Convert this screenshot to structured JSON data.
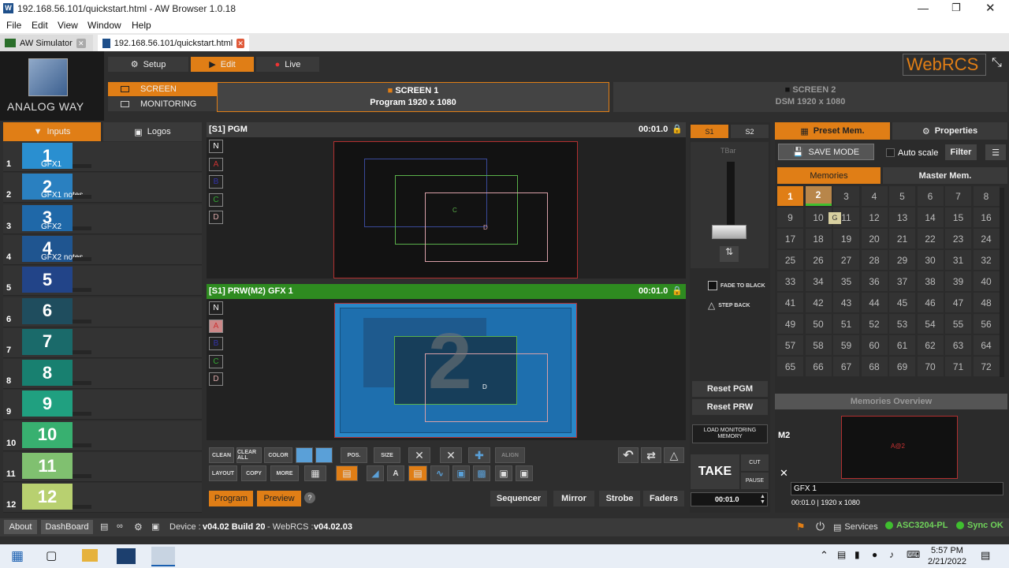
{
  "window": {
    "title": "192.168.56.101/quickstart.html - AW Browser 1.0.18"
  },
  "menu": [
    "File",
    "Edit",
    "View",
    "Window",
    "Help"
  ],
  "tabs": [
    {
      "label": "AW Simulator"
    },
    {
      "label": "192.168.56.101/quickstart.html"
    }
  ],
  "logo": {
    "brand": "ANALOG WAY",
    "webrcs": "WebRCS"
  },
  "modes": {
    "setup": "Setup",
    "edit": "Edit",
    "live": "Live"
  },
  "screens": {
    "screen_label": "SCREEN",
    "monitoring_label": "MONITORING",
    "s1_title": "SCREEN 1",
    "s1_sub": "Program 1920 x 1080",
    "s2_title": "SCREEN 2",
    "s2_sub": "DSM 1920 x 1080"
  },
  "left_tabs": {
    "inputs": "Inputs",
    "logos": "Logos"
  },
  "inputs": [
    {
      "n": "1",
      "big": "1",
      "label": "GFX1",
      "color": "#2a8fd0"
    },
    {
      "n": "2",
      "big": "2",
      "label": "GFX1 notes",
      "color": "#2a80c0"
    },
    {
      "n": "3",
      "big": "3",
      "label": "GFX2",
      "color": "#1f68a8"
    },
    {
      "n": "4",
      "big": "4",
      "label": "GFX2 notes",
      "color": "#1f5590"
    },
    {
      "n": "5",
      "big": "5",
      "label": "",
      "color": "#224488"
    },
    {
      "n": "6",
      "big": "6",
      "label": "",
      "color": "#1f4d5e"
    },
    {
      "n": "7",
      "big": "7",
      "label": "",
      "color": "#1a6a6a"
    },
    {
      "n": "8",
      "big": "8",
      "label": "",
      "color": "#188070"
    },
    {
      "n": "9",
      "big": "9",
      "label": "",
      "color": "#20a080"
    },
    {
      "n": "10",
      "big": "10",
      "label": "",
      "color": "#38b070"
    },
    {
      "n": "11",
      "big": "11",
      "label": "",
      "color": "#80c070"
    },
    {
      "n": "12",
      "big": "12",
      "label": "",
      "color": "#b8d070"
    }
  ],
  "pgm": {
    "title": "[S1] PGM",
    "time": "00:01.0"
  },
  "prw": {
    "title": "[S1] PRW(M2) GFX 1",
    "time": "00:01.0"
  },
  "layers": [
    "N",
    "A",
    "B",
    "C",
    "D"
  ],
  "canvas": {
    "c": "C",
    "d": "D",
    "big": "2"
  },
  "tools": {
    "clean": "CLEAN",
    "clear_all": "CLEAR ALL",
    "color": "COLOR",
    "pos": "POS.",
    "size": "SIZE",
    "align": "ALIGN",
    "layout": "LAYOUT",
    "copy": "COPY",
    "more": "MORE"
  },
  "bottom": {
    "program": "Program",
    "preview": "Preview",
    "help": "?",
    "sequencer": "Sequencer",
    "mirror": "Mirror",
    "strobe": "Strobe",
    "faders": "Faders"
  },
  "tbar": {
    "s1": "S1",
    "s2": "S2",
    "label": "TBar",
    "fade": "FADE TO BLACK",
    "step": "STEP BACK",
    "reset_pgm": "Reset PGM",
    "reset_prw": "Reset PRW",
    "load_mon": "LOAD MONITORING MEMORY",
    "take": "TAKE",
    "cut": "CUT",
    "pause": "PAUSE",
    "time": "00:01.0"
  },
  "right": {
    "preset_tab": "Preset Mem.",
    "props_tab": "Properties",
    "save_mode": "SAVE MODE",
    "autoscale": "Auto scale",
    "filter": "Filter",
    "memories": "Memories",
    "master": "Master Mem.",
    "overview": "Memories Overview",
    "m2": "M2",
    "g_badge": "G",
    "mini_label": "A@2",
    "name_value": "GFX 1",
    "info": "00:01.0 | 1920 x 1080"
  },
  "memories": [
    "1",
    "2",
    "3",
    "4",
    "5",
    "6",
    "7",
    "8",
    "9",
    "10",
    "11",
    "12",
    "13",
    "14",
    "15",
    "16",
    "17",
    "18",
    "19",
    "20",
    "21",
    "22",
    "23",
    "24",
    "25",
    "26",
    "27",
    "28",
    "29",
    "30",
    "31",
    "32",
    "33",
    "34",
    "35",
    "36",
    "37",
    "38",
    "39",
    "40",
    "41",
    "42",
    "43",
    "44",
    "45",
    "46",
    "47",
    "48",
    "49",
    "50",
    "51",
    "52",
    "53",
    "54",
    "55",
    "56",
    "57",
    "58",
    "59",
    "60",
    "61",
    "62",
    "63",
    "64",
    "65",
    "66",
    "67",
    "68",
    "69",
    "70",
    "71",
    "72"
  ],
  "status": {
    "about": "About",
    "dashboard": "DashBoard",
    "device": "Device :",
    "device_ver": "v04.02 Build 20",
    "sep": " - WebRCS : ",
    "webrcs_ver": "v04.02.03",
    "services": "Services",
    "asc": "ASC3204-PL",
    "sync": "Sync OK"
  },
  "clock": {
    "time": "5:57 PM",
    "date": "2/21/2022"
  },
  "colors": {
    "accent": "#e07e16",
    "green": "#2e8b20",
    "red": "#c0392b"
  }
}
